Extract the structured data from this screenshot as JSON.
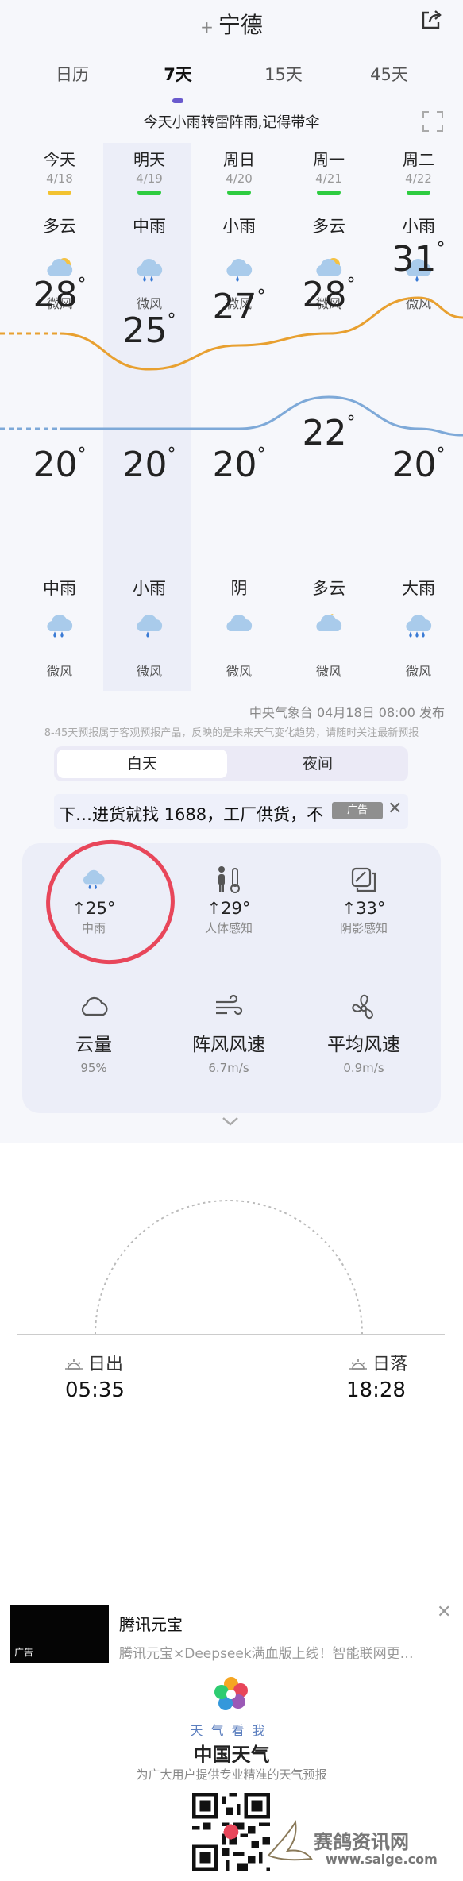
{
  "header": {
    "city": "宁德",
    "add_symbol": "+"
  },
  "tabs": [
    {
      "label": "日历"
    },
    {
      "label": "7天"
    },
    {
      "label": "15天"
    },
    {
      "label": "45天"
    }
  ],
  "alert": "今天小雨转雷阵雨,记得带伞",
  "days": [
    {
      "day": "今天",
      "date": "4/18",
      "bar_color": "#f2c230",
      "day_cond": "多云",
      "day_icon": "partly-cloudy-icon",
      "day_wind": "微风",
      "high": "28",
      "low": "20",
      "night_cond": "中雨",
      "night_icon": "moderate-rain-icon",
      "night_wind": "微风"
    },
    {
      "day": "明天",
      "date": "4/19",
      "bar_color": "#2ecc40",
      "day_cond": "中雨",
      "day_icon": "moderate-rain-icon",
      "day_wind": "微风",
      "high": "25",
      "low": "20",
      "night_cond": "小雨",
      "night_icon": "light-rain-icon",
      "night_wind": "微风"
    },
    {
      "day": "周日",
      "date": "4/20",
      "bar_color": "#2ecc40",
      "day_cond": "小雨",
      "day_icon": "light-rain-icon",
      "day_wind": "微风",
      "high": "27",
      "low": "20",
      "night_cond": "阴",
      "night_icon": "overcast-icon",
      "night_wind": "微风"
    },
    {
      "day": "周一",
      "date": "4/21",
      "bar_color": "#2ecc40",
      "day_cond": "多云",
      "day_icon": "partly-cloudy-icon",
      "day_wind": "微风",
      "high": "28",
      "low": "22",
      "night_cond": "多云",
      "night_icon": "cloudy-night-icon",
      "night_wind": "微风"
    },
    {
      "day": "周二",
      "date": "4/22",
      "bar_color": "#2ecc40",
      "day_cond": "小雨",
      "day_icon": "light-rain-icon",
      "day_wind": "微风",
      "high": "31",
      "low": "20",
      "night_cond": "大雨",
      "night_icon": "heavy-rain-icon",
      "night_wind": "微风"
    }
  ],
  "source": "中央气象台 04月18日 08:00 发布",
  "disclaimer": "8-45天预报属于客观预报产品，反映的是未来天气变化趋势，请随时关注最新预报",
  "toggle": {
    "day": "白天",
    "night": "夜间"
  },
  "ad_marquee": {
    "text": "下…进货就找 1688，工厂供货，不",
    "badge": "广告"
  },
  "details": [
    {
      "icon": "moderate-rain-icon",
      "value": "↑25°",
      "label": "中雨"
    },
    {
      "icon": "thermometer-person-icon",
      "value": "↑29°",
      "label": "人体感知"
    },
    {
      "icon": "shade-icon",
      "value": "↑33°",
      "label": "阴影感知"
    },
    {
      "icon": "cloud-outline-icon",
      "value": "云量",
      "label": "95%"
    },
    {
      "icon": "gust-wind-icon",
      "value": "阵风风速",
      "label": "6.7m/s"
    },
    {
      "icon": "fan-icon",
      "value": "平均风速",
      "label": "0.9m/s"
    }
  ],
  "sun": {
    "rise_label": "日出",
    "rise_time": "05:35",
    "set_label": "日落",
    "set_time": "18:28"
  },
  "ad_bottom": {
    "title": "腾讯元宝",
    "desc": "腾讯元宝×Deepseek满血版上线！智能联网更…",
    "badge": "广告"
  },
  "footer": {
    "slogan": "天气看我",
    "brand": "中国天气",
    "tagline": "为广大用户提供专业精准的天气预报"
  },
  "watermark": {
    "name": "赛鸽资讯网",
    "url": "www.saige.com"
  },
  "colors": {
    "accent": "#6a5acd",
    "high_line": "#e8a030",
    "low_line": "#7ea9d8",
    "circle_mark": "#e8465a"
  }
}
